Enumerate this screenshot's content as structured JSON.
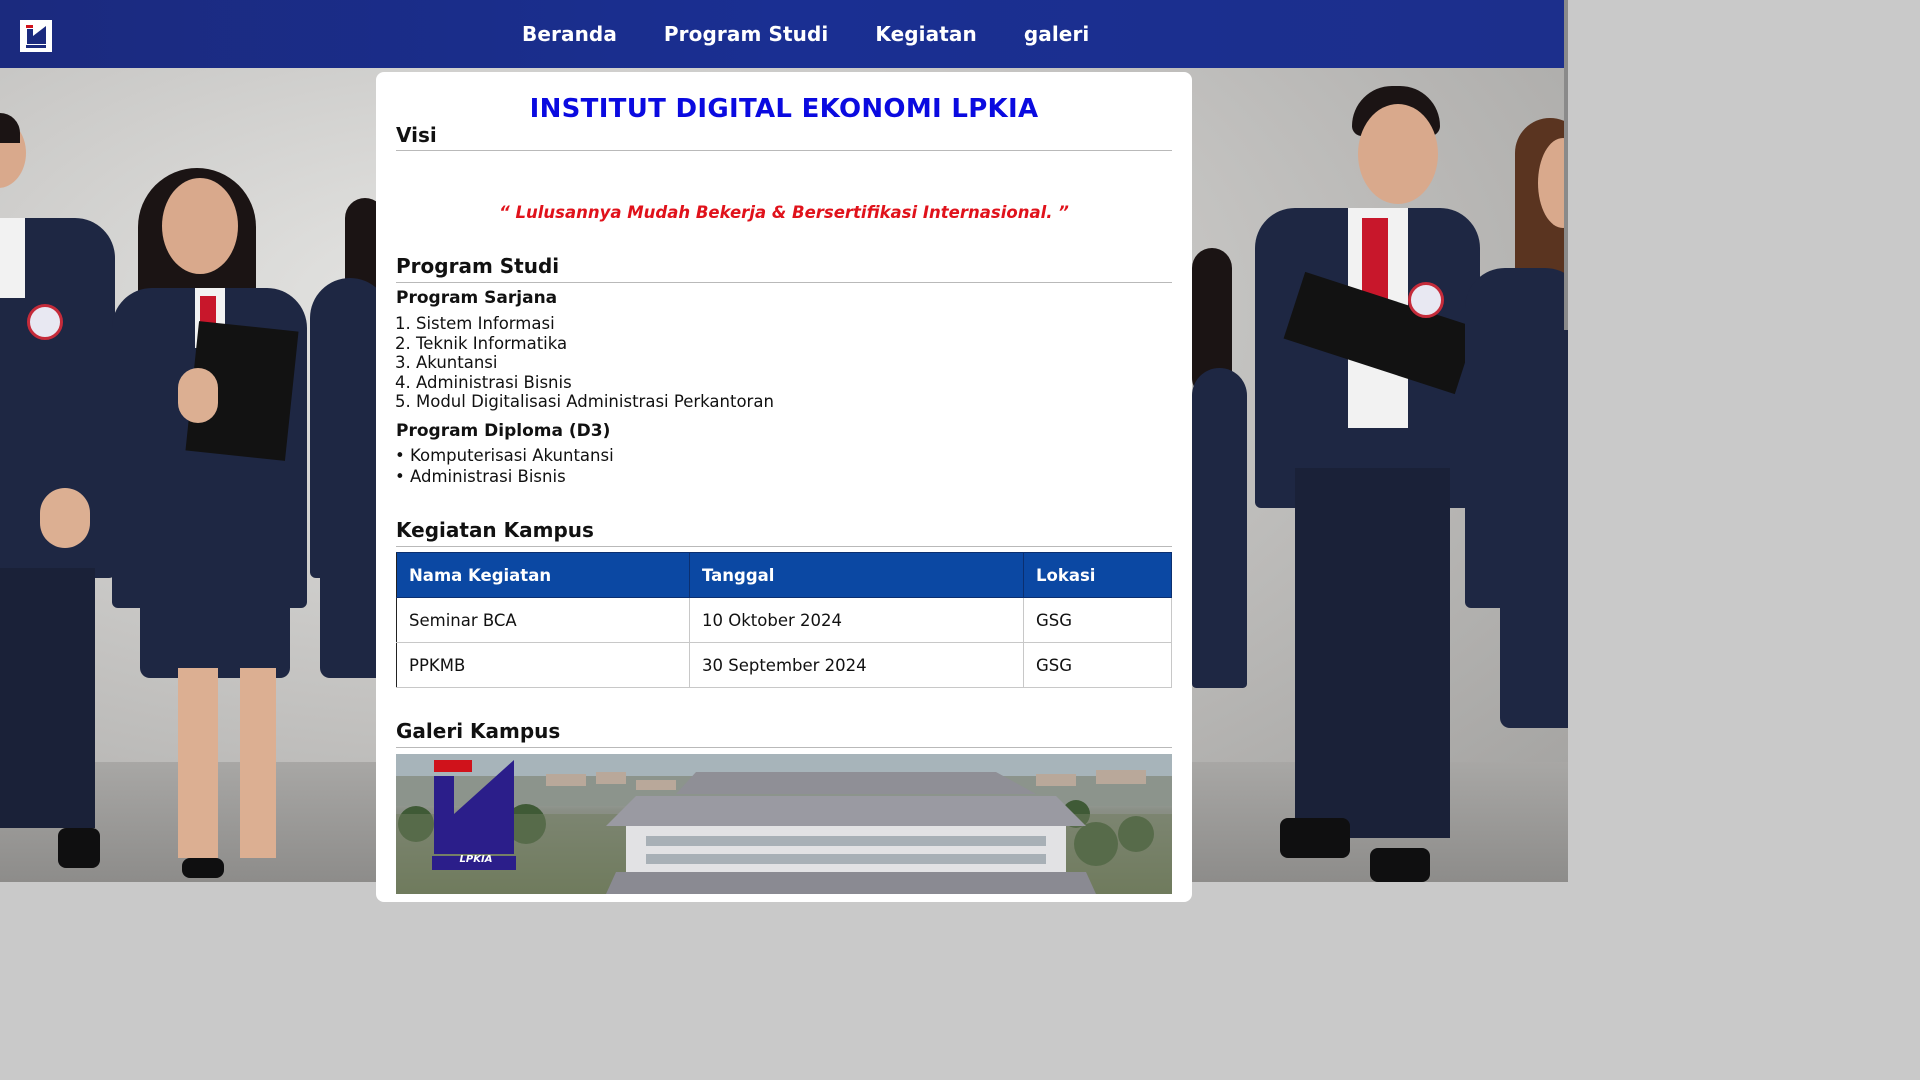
{
  "navbar": {
    "logo_icon": "lpkia-logo",
    "links": [
      "Beranda",
      "Program Studi",
      "Kegiatan",
      "galeri"
    ]
  },
  "main": {
    "title": "INSTITUT DIGITAL EKONOMI LPKIA",
    "visi": {
      "heading": "Visi",
      "quote": "“ Lulusannya Mudah Bekerja & Bersertifikasi Internasional. ”"
    },
    "program_studi": {
      "heading": "Program Studi",
      "sarjana": {
        "heading": "Program Sarjana",
        "items": [
          "1. Sistem Informasi",
          "2. Teknik Informatika",
          "3. Akuntansi",
          "4. Administrasi Bisnis",
          "5. Modul Digitalisasi Administrasi Perkantoran"
        ]
      },
      "diploma": {
        "heading": "Program Diploma (D3)",
        "items": [
          "• Komputerisasi Akuntansi",
          "• Administrasi Bisnis"
        ]
      }
    },
    "kegiatan": {
      "heading": "Kegiatan Kampus",
      "columns": [
        "Nama Kegiatan",
        "Tanggal",
        "Lokasi"
      ],
      "rows": [
        [
          "Seminar BCA",
          "10 Oktober 2024",
          "GSG"
        ],
        [
          "PPKMB",
          "30 September 2024",
          "GSG"
        ]
      ]
    },
    "galeri": {
      "heading": "Galeri Kampus",
      "logo_text": "LPKIA"
    }
  },
  "colors": {
    "navbar": "#1a2f92",
    "title": "#0a0ae0",
    "quote": "#e0121b",
    "table_header": "#0b48a3"
  }
}
